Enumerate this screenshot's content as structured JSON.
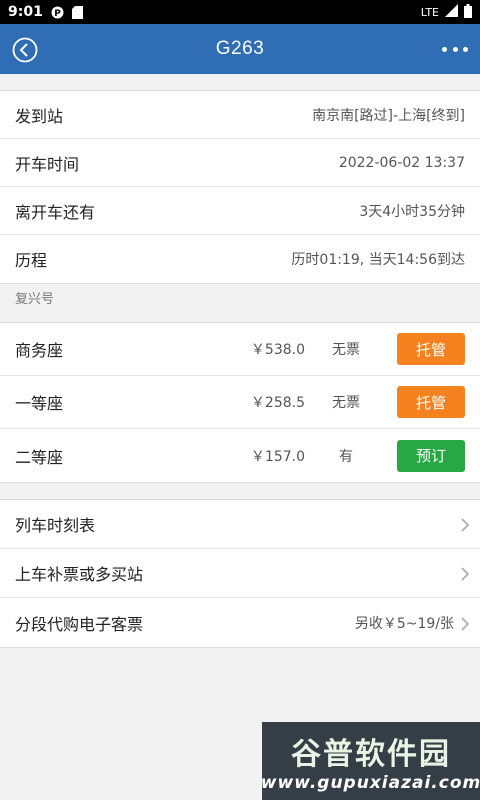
{
  "status_bar": {
    "time": "9:01",
    "network": "LTE"
  },
  "header": {
    "title": "G263"
  },
  "trip_info": [
    {
      "label": "发到站",
      "value": "南京南[路过]-上海[终到]"
    },
    {
      "label": "开车时间",
      "value": "2022-06-02 13:37"
    },
    {
      "label": "离开车还有",
      "value": "3天4小时35分钟"
    },
    {
      "label": "历程",
      "value": "历时01:19, 当天14:56到达"
    }
  ],
  "train_type": "复兴号",
  "seats": [
    {
      "name": "商务座",
      "price": "￥538.0",
      "availability": "无票",
      "action": "托管",
      "action_color": "#f5821f"
    },
    {
      "name": "一等座",
      "price": "￥258.5",
      "availability": "无票",
      "action": "托管",
      "action_color": "#f5821f"
    },
    {
      "name": "二等座",
      "price": "￥157.0",
      "availability": "有",
      "action": "预订",
      "action_color": "#28a745"
    }
  ],
  "links": [
    {
      "label": "列车时刻表",
      "extra": ""
    },
    {
      "label": "上车补票或多买站",
      "extra": ""
    },
    {
      "label": "分段代购电子客票",
      "extra": "另收￥5~19/张"
    }
  ],
  "watermark": {
    "title": "谷普软件园",
    "url": "www.gupuxiazai.com"
  },
  "colors": {
    "header_bg": "#2f6db5",
    "orange_button": "#f5821f",
    "green_button": "#28a745"
  }
}
